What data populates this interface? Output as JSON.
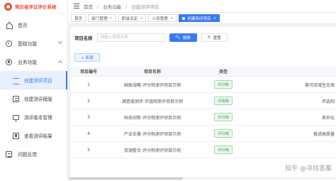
{
  "app": {
    "title": "简历者评议评价系统"
  },
  "sidebar": {
    "items": [
      {
        "label": "首页",
        "icon": "home-icon"
      },
      {
        "label": "基础功能",
        "icon": "gear-icon"
      },
      {
        "label": "业务功能",
        "icon": "business-icon"
      }
    ],
    "sub_items": [
      {
        "label": "创建测评项目",
        "icon": "list-icon",
        "active": true
      },
      {
        "label": "创建测评模版",
        "icon": "document-icon"
      },
      {
        "label": "测评版本管理",
        "icon": "monitor-icon"
      },
      {
        "label": "查看测评结果",
        "icon": "result-icon"
      }
    ],
    "footer_item": {
      "label": "问题反馈",
      "icon": "feedback-icon"
    }
  },
  "header": {
    "breadcrumb": [
      "首页",
      "业务功能",
      "创建测评项目"
    ],
    "separator": "/"
  },
  "tags": [
    {
      "label": "首页"
    },
    {
      "label": "部门管理"
    },
    {
      "label": "职级设定"
    },
    {
      "label": "人员管理"
    },
    {
      "label": "创建测评项目",
      "active": true
    }
  ],
  "tag_close": "×",
  "search": {
    "label": "项目名称",
    "placeholder": "请输入项目名称",
    "search_btn": "搜索",
    "reset_btn": "重置"
  },
  "add_btn": "+ 新增",
  "table": {
    "headers": [
      "项目编号",
      "项目名称",
      "类型"
    ],
    "rows": [
      {
        "no": "1",
        "name": "国家战略-评分制测评项目示例",
        "type": "评分制",
        "ext": "黄河流域生态保"
      },
      {
        "no": "2",
        "name": "满意度测评-评选制测评项目示例",
        "type": "评选制",
        "ext": "评选制"
      },
      {
        "no": "3",
        "name": "科技创新-评分制测评项目示例",
        "type": "评分制",
        "ext": "差异化"
      },
      {
        "no": "4",
        "name": "产业支撑-评分制测评项目示例",
        "type": "评分制",
        "ext": "推进高质量"
      },
      {
        "no": "5",
        "name": "资源整合-评分制测评项目示例",
        "type": "评分制",
        "ext": ""
      }
    ]
  },
  "watermark": "知乎 @寻找答案",
  "colors": {
    "accent": "#3a7af0",
    "brand": "#e8523f",
    "badge": "#3aa75a"
  }
}
